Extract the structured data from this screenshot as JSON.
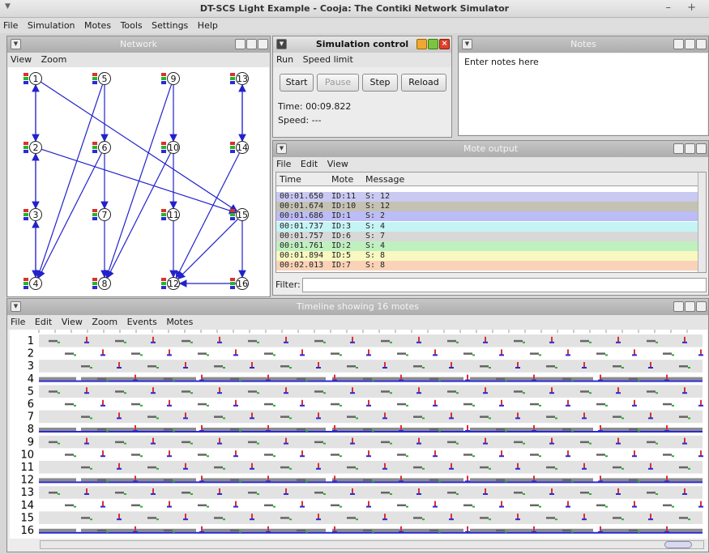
{
  "window": {
    "title": "DT-SCS Light Example - Cooja: The Contiki Network Simulator",
    "controls": "– +"
  },
  "menubar": [
    "File",
    "Simulation",
    "Motes",
    "Tools",
    "Settings",
    "Help"
  ],
  "network": {
    "title": "Network",
    "menu": [
      "View",
      "Zoom"
    ],
    "motes": [
      {
        "id": "1",
        "col": 0,
        "row": 0
      },
      {
        "id": "5",
        "col": 1,
        "row": 0
      },
      {
        "id": "9",
        "col": 2,
        "row": 0
      },
      {
        "id": "13",
        "col": 3,
        "row": 0
      },
      {
        "id": "2",
        "col": 0,
        "row": 1
      },
      {
        "id": "6",
        "col": 1,
        "row": 1
      },
      {
        "id": "10",
        "col": 2,
        "row": 1
      },
      {
        "id": "14",
        "col": 3,
        "row": 1
      },
      {
        "id": "3",
        "col": 0,
        "row": 2
      },
      {
        "id": "7",
        "col": 1,
        "row": 2
      },
      {
        "id": "11",
        "col": 2,
        "row": 2
      },
      {
        "id": "15",
        "col": 3,
        "row": 2
      },
      {
        "id": "4",
        "col": 0,
        "row": 3
      },
      {
        "id": "8",
        "col": 1,
        "row": 3
      },
      {
        "id": "12",
        "col": 2,
        "row": 3
      },
      {
        "id": "16",
        "col": 3,
        "row": 3
      }
    ],
    "links": [
      [
        "1",
        "2"
      ],
      [
        "2",
        "1"
      ],
      [
        "2",
        "3"
      ],
      [
        "3",
        "2"
      ],
      [
        "3",
        "4"
      ],
      [
        "4",
        "3"
      ],
      [
        "5",
        "6"
      ],
      [
        "6",
        "7"
      ],
      [
        "7",
        "8"
      ],
      [
        "9",
        "10"
      ],
      [
        "10",
        "11"
      ],
      [
        "11",
        "12"
      ],
      [
        "13",
        "14"
      ],
      [
        "14",
        "13"
      ],
      [
        "15",
        "16"
      ],
      [
        "16",
        "12"
      ],
      [
        "1",
        "15"
      ],
      [
        "2",
        "15"
      ],
      [
        "5",
        "4"
      ],
      [
        "6",
        "4"
      ],
      [
        "9",
        "8"
      ],
      [
        "10",
        "8"
      ],
      [
        "14",
        "12"
      ],
      [
        "15",
        "12"
      ]
    ]
  },
  "simcontrol": {
    "title": "Simulation control",
    "menu": [
      "Run",
      "Speed limit"
    ],
    "buttons": {
      "start": "Start",
      "pause": "Pause",
      "step": "Step",
      "reload": "Reload"
    },
    "time": "Time: 00:09.822",
    "speed": "Speed: ---"
  },
  "notes": {
    "title": "Notes",
    "text": "Enter notes here"
  },
  "moteoutput": {
    "title": "Mote output",
    "menu": [
      "File",
      "Edit",
      "View"
    ],
    "columns": [
      "Time",
      "Mote",
      "Message"
    ],
    "rows": [
      {
        "time": "00:01.650",
        "mote": "ID:11",
        "msg": "S: 12",
        "color": "#c9c9f2"
      },
      {
        "time": "00:01.674",
        "mote": "ID:10",
        "msg": "S: 12",
        "color": "#c4c2b2"
      },
      {
        "time": "00:01.686",
        "mote": "ID:1",
        "msg": "S: 2",
        "color": "#bcbcf6"
      },
      {
        "time": "00:01.737",
        "mote": "ID:3",
        "msg": "S: 4",
        "color": "#c4f4f4"
      },
      {
        "time": "00:01.757",
        "mote": "ID:6",
        "msg": "S: 7",
        "color": "#d8d8d8"
      },
      {
        "time": "00:01.761",
        "mote": "ID:2",
        "msg": "S: 4",
        "color": "#bff0bf"
      },
      {
        "time": "00:01.894",
        "mote": "ID:5",
        "msg": "S: 8",
        "color": "#f8f8c0"
      },
      {
        "time": "00:02.013",
        "mote": "ID:7",
        "msg": "S: 8",
        "color": "#fad2b8"
      }
    ],
    "filter_label": "Filter:"
  },
  "timeline": {
    "title": "Timeline showing 16 motes",
    "menu": [
      "File",
      "Edit",
      "View",
      "Zoom",
      "Events",
      "Motes"
    ],
    "rows": [
      "1",
      "2",
      "3",
      "4",
      "5",
      "6",
      "7",
      "8",
      "9",
      "10",
      "11",
      "12",
      "13",
      "14",
      "15",
      "16"
    ]
  },
  "colors": {
    "link": "#2222cc",
    "radio_on": "#8c8c8c",
    "led_red": "#d93030",
    "led_green": "#28b428",
    "led_blue": "#2a2ad6"
  }
}
